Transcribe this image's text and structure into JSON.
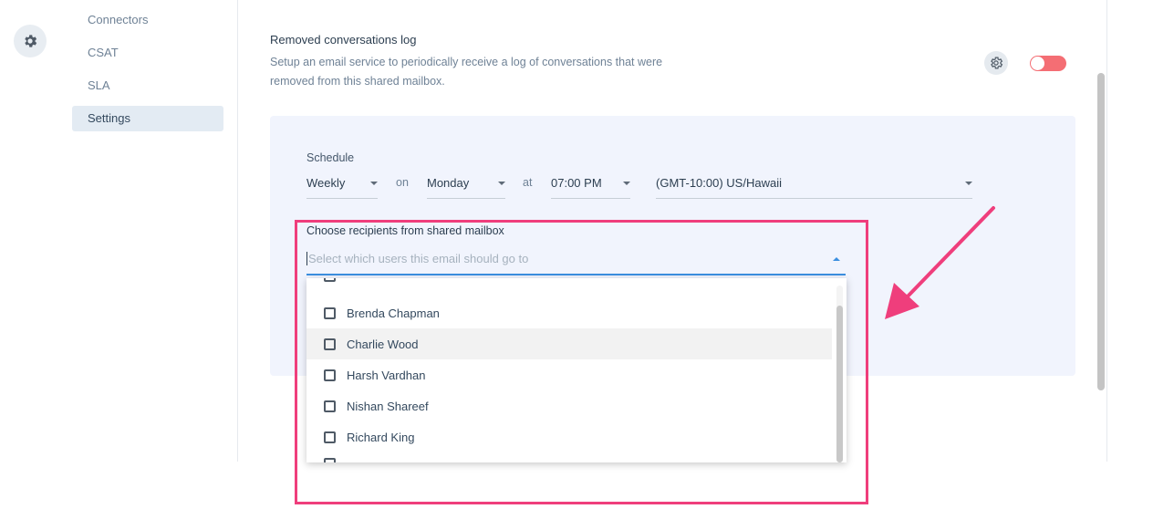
{
  "nav": {
    "items": [
      {
        "label": "Connectors",
        "active": false
      },
      {
        "label": "CSAT",
        "active": false
      },
      {
        "label": "SLA",
        "active": false
      },
      {
        "label": "Settings",
        "active": true
      }
    ]
  },
  "section": {
    "title": "Removed conversations log",
    "description": "Setup an email service to periodically receive a log of conversations that were removed from this shared mailbox.",
    "toggle_on": false
  },
  "schedule": {
    "label": "Schedule",
    "frequency": "Weekly",
    "on_label": "on",
    "day": "Monday",
    "at_label": "at",
    "time": "07:00 PM",
    "timezone": "(GMT-10:00) US/Hawaii"
  },
  "recipients": {
    "label": "Choose recipients from shared mailbox",
    "placeholder": "Select which users this email should go to",
    "options": [
      {
        "name": "Brenda Chapman",
        "checked": false
      },
      {
        "name": "Charlie Wood",
        "checked": false,
        "highlighted": true
      },
      {
        "name": "Harsh Vardhan",
        "checked": false
      },
      {
        "name": "Nishan Shareef",
        "checked": false
      },
      {
        "name": "Richard King",
        "checked": false
      }
    ]
  },
  "colors": {
    "accent": "#3b8fe0",
    "toggle_off": "#f46e74",
    "annotation": "#ef3e7c",
    "panel_bg": "#f1f4fd"
  }
}
